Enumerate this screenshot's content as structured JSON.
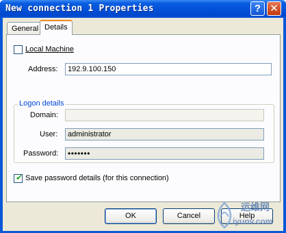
{
  "window": {
    "title": "New connection 1 Properties",
    "help_glyph": "?",
    "close_glyph": "✕"
  },
  "tabs": [
    {
      "label": "General",
      "active": false
    },
    {
      "label": "Details",
      "active": true
    }
  ],
  "details": {
    "local_machine": {
      "label": "Local Machine",
      "checked": false
    },
    "address": {
      "label": "Address:",
      "value": "192.9.100.150"
    },
    "logon": {
      "legend": "Logon details",
      "domain": {
        "label": "Domain:",
        "value": ""
      },
      "user": {
        "label": "User:",
        "value": "administrator"
      },
      "password": {
        "label": "Password:",
        "value": "•••••••"
      }
    },
    "save_password": {
      "label": "Save password details (for this connection)",
      "checked": true,
      "mark": "✔"
    }
  },
  "buttons": {
    "ok": "OK",
    "cancel": "Cancel",
    "help": "Help"
  },
  "watermark": {
    "text_cn": "运维网",
    "url": "iyunv.com"
  },
  "colors": {
    "titlebar": "#0a5de0",
    "dialog_bg": "#ece9d8",
    "group_legend": "#0046d5",
    "active_tab_accent": "#e68b2c"
  }
}
